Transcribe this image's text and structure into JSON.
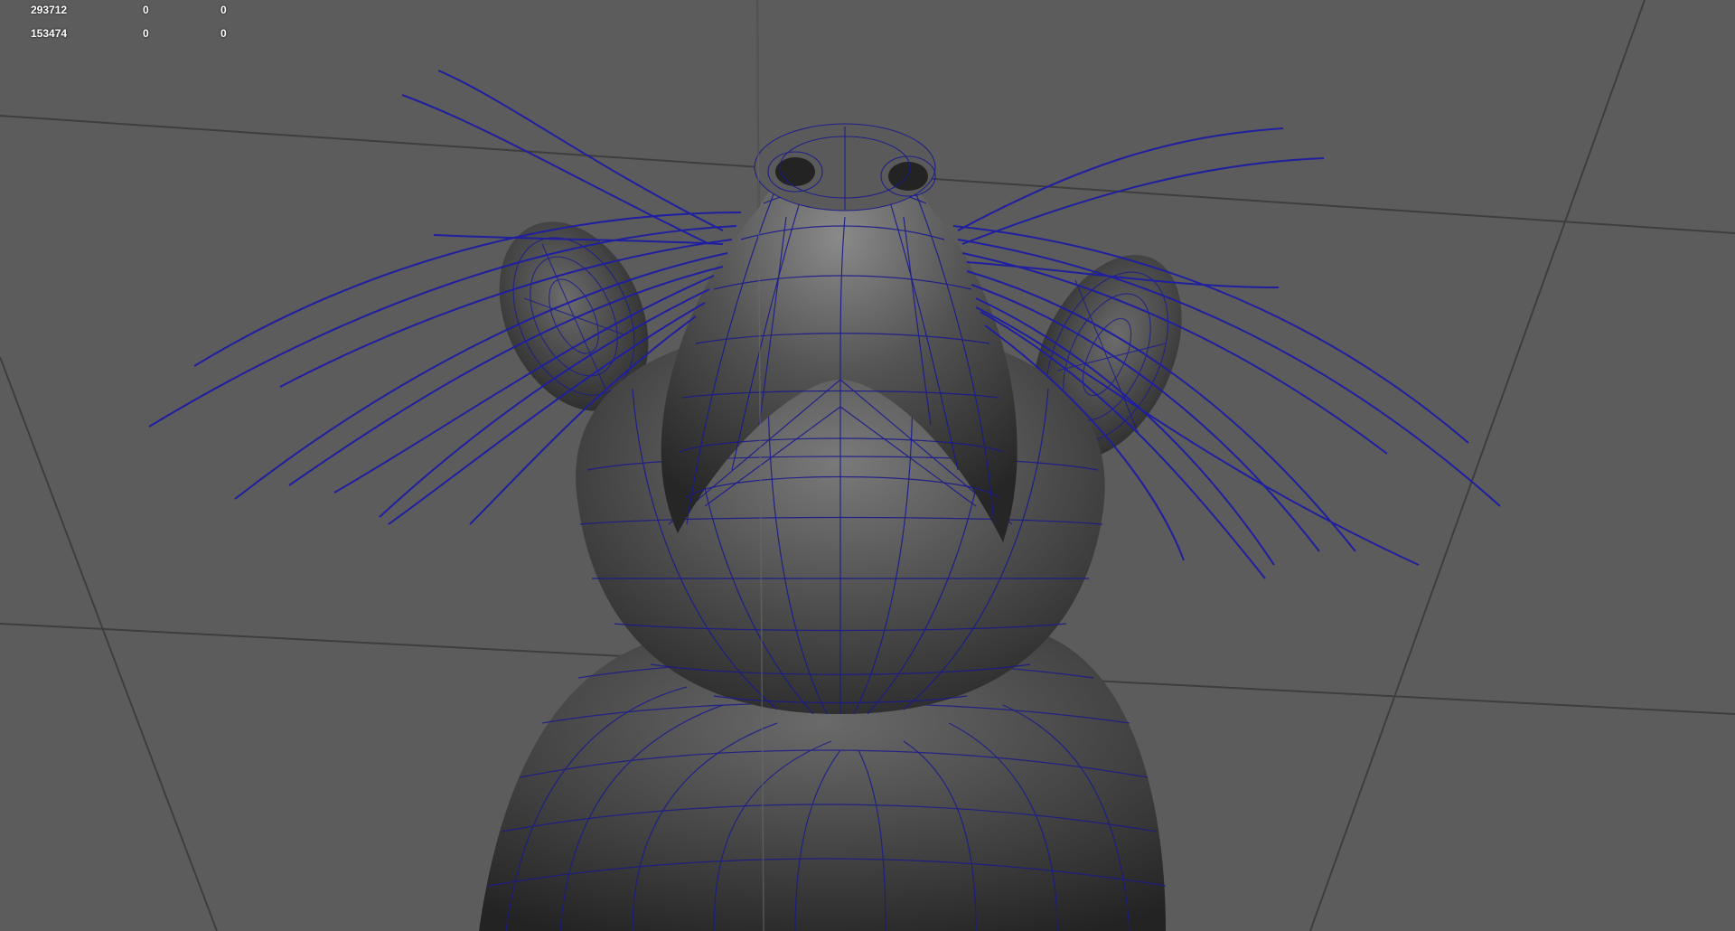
{
  "viewport": {
    "background_color": "#5c5c5c",
    "grid_color": "#3e3e3e",
    "mesh_color": "#4a4a4a",
    "wire_color": "#1a1a8c",
    "whisker_color": "#1f1fa0"
  },
  "hud": {
    "rows": [
      {
        "a": "293712",
        "b": "0",
        "c": "0"
      },
      {
        "a": "153474",
        "b": "0",
        "c": "0"
      }
    ]
  }
}
